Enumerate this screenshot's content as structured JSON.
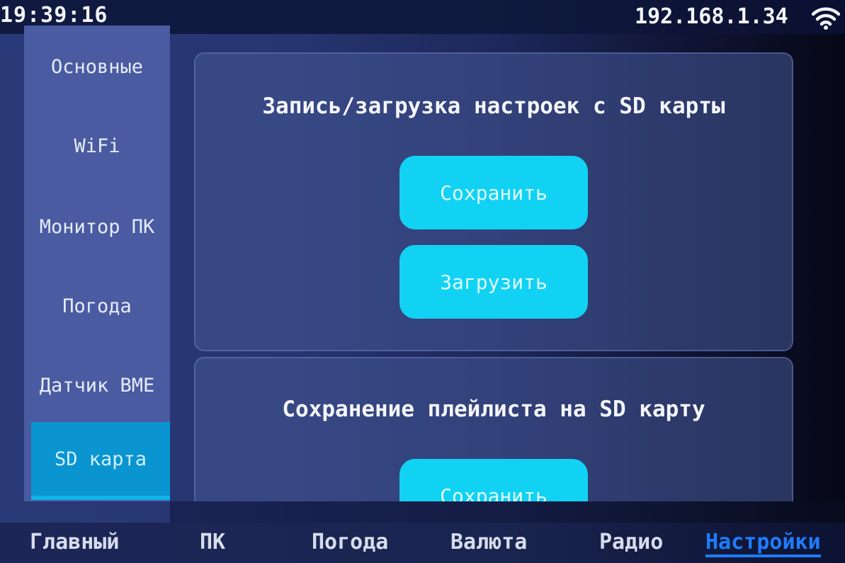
{
  "status_bar": {
    "time": "19:39:16",
    "ip_address": "192.168.1.34",
    "wifi_icon": "wifi-icon"
  },
  "sidebar": {
    "items": [
      {
        "label": "Основные",
        "active": false
      },
      {
        "label": "WiFi",
        "active": false
      },
      {
        "label": "Монитор ПК",
        "active": false
      },
      {
        "label": "Погода",
        "active": false
      },
      {
        "label": "Датчик BME",
        "active": false
      },
      {
        "label": "SD карта",
        "active": true
      }
    ]
  },
  "settings_card": {
    "title": "Запись/загрузка настроек с SD карты",
    "save_label": "Сохранить",
    "load_label": "Загрузить"
  },
  "playlist_card": {
    "title": "Сохранение плейлиста на SD карту",
    "save_label": "Сохранить"
  },
  "tabs": [
    {
      "label": "Главный",
      "active": false
    },
    {
      "label": "ПК",
      "active": false
    },
    {
      "label": "Погода",
      "active": false
    },
    {
      "label": "Валюта",
      "active": false
    },
    {
      "label": "Радио",
      "active": false
    },
    {
      "label": "Настройки",
      "active": true
    }
  ],
  "colors": {
    "button": "#12d2f4",
    "sidebar": "#4a5ba2",
    "sidebar_active": "#0a95d0",
    "tab_active": "#1e7cff"
  }
}
